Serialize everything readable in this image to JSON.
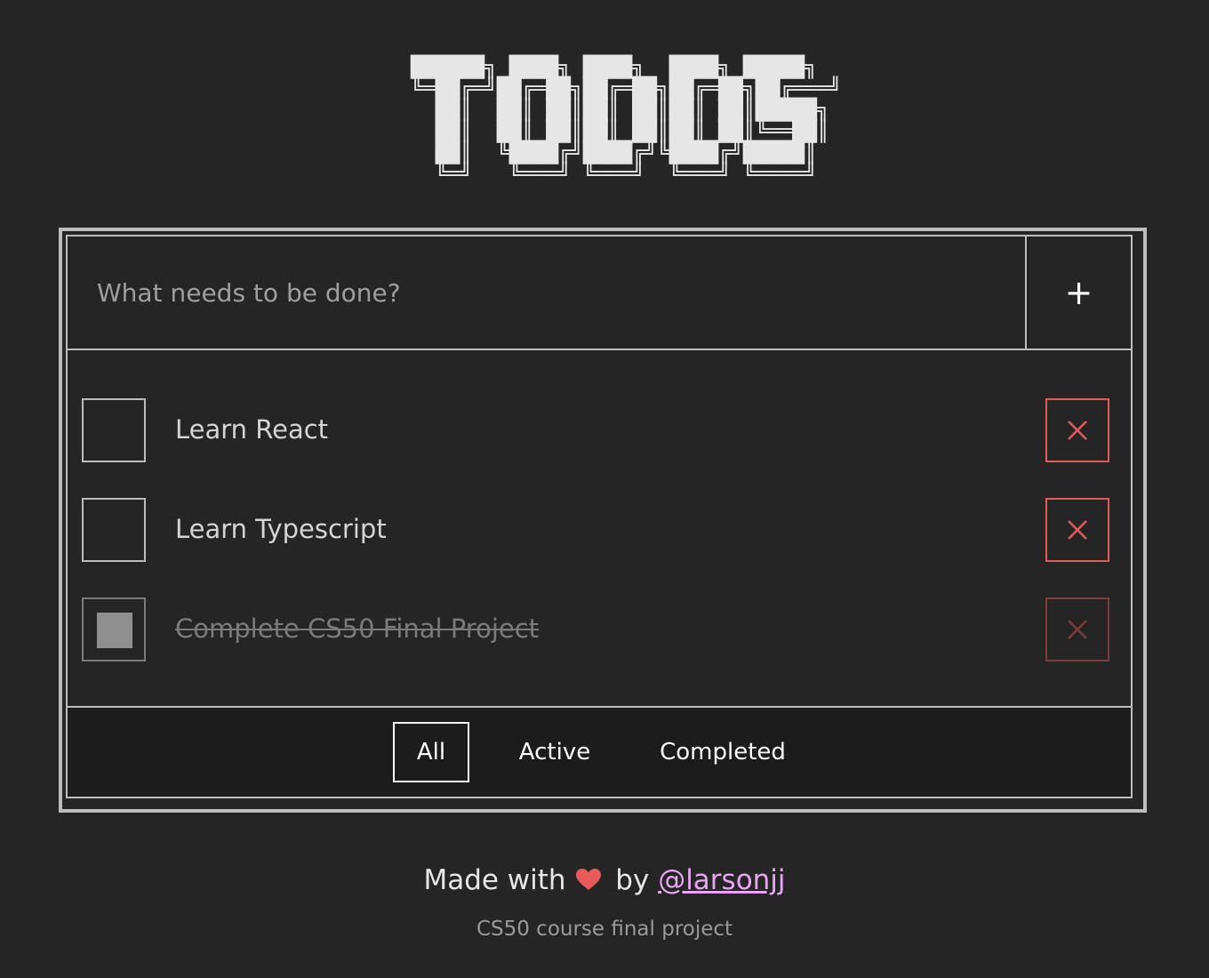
{
  "header": {
    "logo_art": "██████╗ ████╗ ████╗  ████╗ █████╗\n╚═██╔═╝██╔═██╗██╔═██╗██╔═██╗██╔═══╝\n  ██║  ██║ ██║██║ ██║██║ ██║█████╗ \n  ██║  ██║ ██║██║ ██║██║ ██║╚══██║ \n  ██║  ╚████╔╝████╔╝╚████╔╝█████║ \n  ╚═╝   ╚═══╝ ╚═══╝  ╚═══╝ ╚════╝ ",
    "logo_alt": "TODOS"
  },
  "new_todo": {
    "placeholder": "What needs to be done?",
    "value": "",
    "add_label": "+"
  },
  "todos": [
    {
      "text": "Learn React",
      "completed": false
    },
    {
      "text": "Learn Typescript",
      "completed": false
    },
    {
      "text": "Complete CS50 Final Project",
      "completed": true
    }
  ],
  "filters": {
    "items": [
      "All",
      "Active",
      "Completed"
    ],
    "selected": "All"
  },
  "footer": {
    "made_with": "Made with",
    "by": "by",
    "author": "@larsonjj",
    "note": "CS50 course final project"
  },
  "colors": {
    "background": "#252525",
    "border": "#bdbdbd",
    "delete_accent": "#e05a5a",
    "heart": "#e85a5a",
    "link": "#e8a6f2"
  },
  "icons": {
    "add": "plus-icon",
    "delete": "close-icon",
    "heart": "heart-icon"
  }
}
